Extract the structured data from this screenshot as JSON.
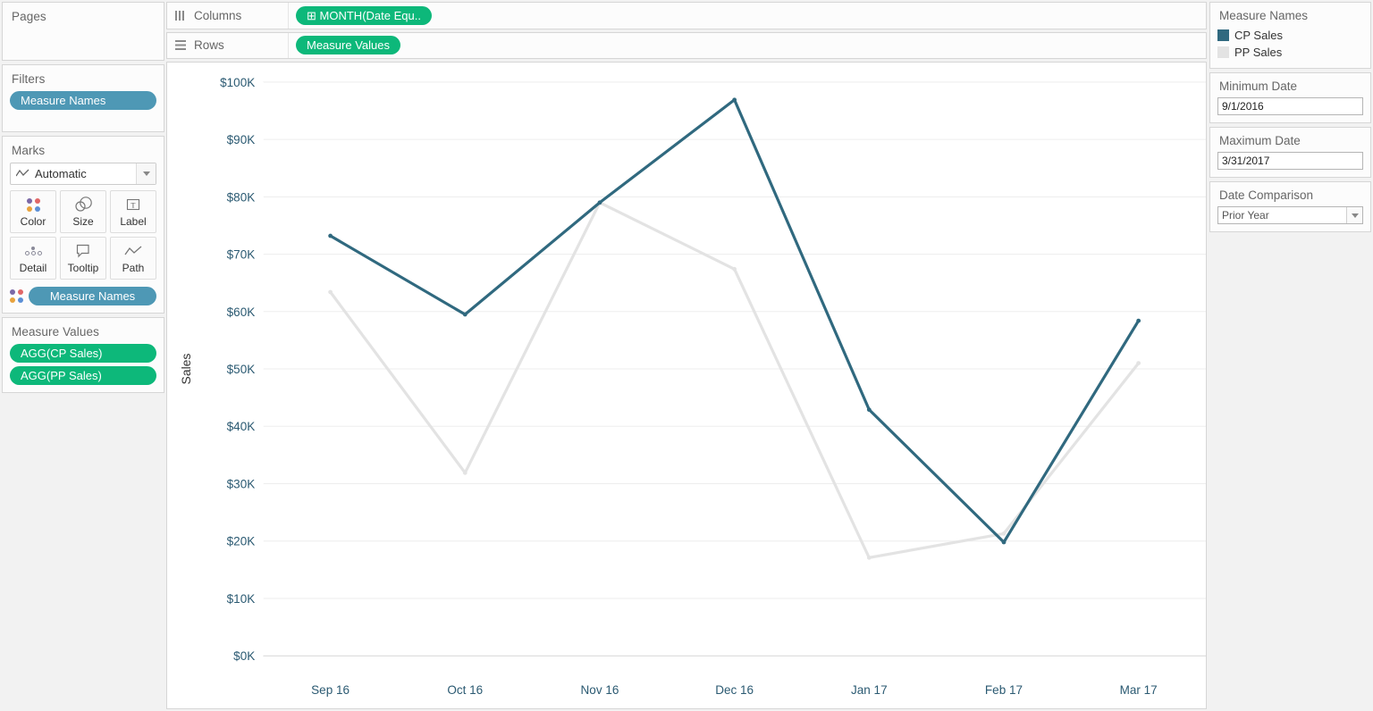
{
  "left_panel": {
    "pages": {
      "title": "Pages"
    },
    "filters": {
      "title": "Filters",
      "pills": [
        "Measure Names"
      ]
    },
    "marks": {
      "title": "Marks",
      "mark_type": "Automatic",
      "buttons": [
        {
          "label": "Color",
          "icon": "color-dots-icon"
        },
        {
          "label": "Size",
          "icon": "size-circles-icon"
        },
        {
          "label": "Label",
          "icon": "label-text-icon"
        },
        {
          "label": "Detail",
          "icon": "detail-dots-icon"
        },
        {
          "label": "Tooltip",
          "icon": "tooltip-bubble-icon"
        },
        {
          "label": "Path",
          "icon": "path-line-icon"
        }
      ],
      "encoding_pill": "Measure Names"
    },
    "measure_values": {
      "title": "Measure Values",
      "pills": [
        "AGG(CP Sales)",
        "AGG(PP Sales)"
      ]
    }
  },
  "shelves": {
    "columns": {
      "label": "Columns",
      "icon": "columns-icon",
      "pill": "MONTH(Date Equ..",
      "pill_prefix": "⊞"
    },
    "rows": {
      "label": "Rows",
      "icon": "rows-icon",
      "pill": "Measure Values"
    }
  },
  "right_panel": {
    "legend": {
      "title": "Measure Names",
      "items": [
        {
          "label": "CP Sales",
          "color": "#30697f"
        },
        {
          "label": "PP Sales",
          "color": "#e3e3e3"
        }
      ]
    },
    "min_date": {
      "title": "Minimum Date",
      "value": "9/1/2016"
    },
    "max_date": {
      "title": "Maximum Date",
      "value": "3/31/2017"
    },
    "date_comparison": {
      "title": "Date Comparison",
      "value": "Prior Year"
    }
  },
  "chart_data": {
    "type": "line",
    "title": "",
    "xlabel": "",
    "ylabel": "Sales",
    "categories": [
      "Sep 16",
      "Oct 16",
      "Nov 16",
      "Dec 16",
      "Jan 17",
      "Feb 17",
      "Mar 17"
    ],
    "series": [
      {
        "name": "CP Sales",
        "color": "#30697f",
        "values": [
          73200,
          59500,
          79000,
          96900,
          42900,
          19800,
          58400
        ]
      },
      {
        "name": "PP Sales",
        "color": "#e3e3e3",
        "values": [
          63400,
          31900,
          79000,
          67400,
          17100,
          21300,
          51000
        ]
      }
    ],
    "ylim": [
      0,
      100000
    ],
    "ytick_step": 10000,
    "ytick_labels": [
      "$100K",
      "$90K",
      "$80K",
      "$70K",
      "$60K",
      "$50K",
      "$40K",
      "$30K",
      "$20K",
      "$10K",
      "$0K"
    ],
    "ytick_values": [
      100000,
      90000,
      80000,
      70000,
      60000,
      50000,
      40000,
      30000,
      20000,
      10000,
      0
    ],
    "grid": true,
    "legend_position": "right"
  }
}
